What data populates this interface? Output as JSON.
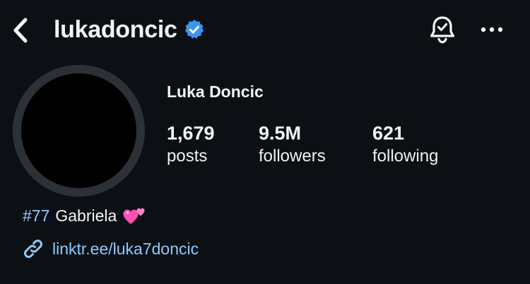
{
  "header": {
    "username": "lukadoncic",
    "back_icon": "chevron-left-icon",
    "verified_icon": "verified-badge-icon",
    "notification_icon": "bell-check-icon",
    "more_icon": "more-horizontal-icon"
  },
  "profile": {
    "display_name": "Luka Doncic",
    "stats": [
      {
        "value": "1,679",
        "label": "posts"
      },
      {
        "value": "9.5M",
        "label": "followers"
      },
      {
        "value": "621",
        "label": "following"
      }
    ],
    "bio": {
      "hashtag": "#77",
      "name": "Gabriela",
      "emoji_icon": "two-hearts-emoji-icon"
    },
    "link": {
      "icon": "link-icon",
      "text": "linktr.ee/luka7doncic"
    }
  },
  "colors": {
    "background": "#0c1015",
    "text": "#f5f5f5",
    "link": "#8fcaff",
    "verified": "#3897f0",
    "avatar_ring": "#2c3138"
  }
}
